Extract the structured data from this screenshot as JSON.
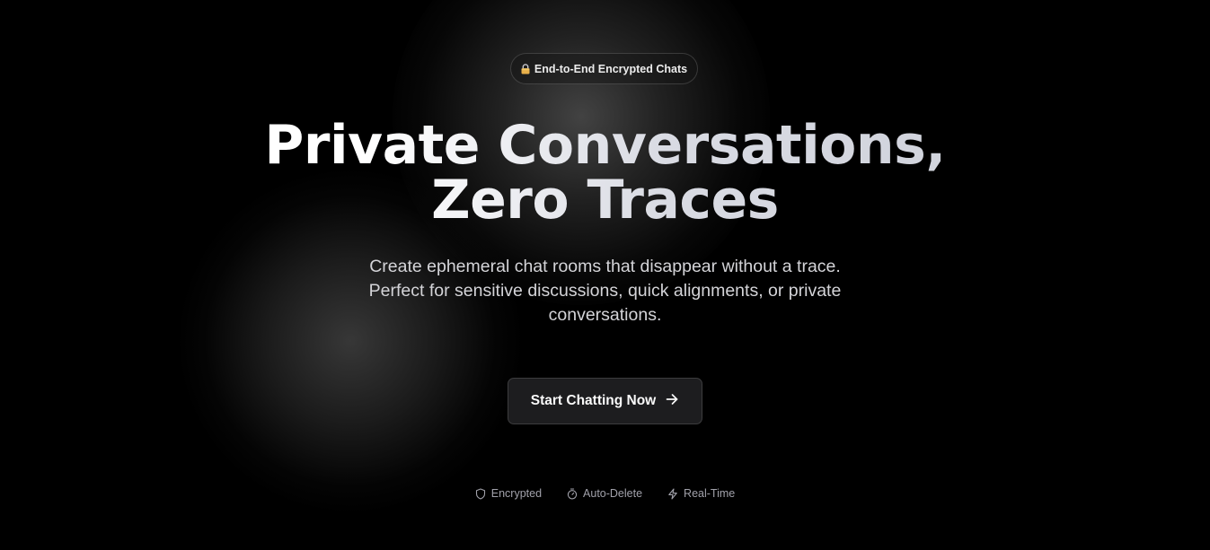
{
  "badge": {
    "icon": "lock-icon",
    "label": "End-to-End Encrypted Chats"
  },
  "hero": {
    "title_line1": "Private Conversations,",
    "title_line2": "Zero Traces",
    "subtitle": "Create ephemeral chat rooms that disappear without a trace. Perfect for sensitive discussions, quick alignments, or private conversations."
  },
  "cta": {
    "label": "Start Chatting Now",
    "icon": "arrow-right-icon"
  },
  "features": [
    {
      "icon": "shield-icon",
      "label": "Encrypted"
    },
    {
      "icon": "timer-icon",
      "label": "Auto-Delete"
    },
    {
      "icon": "zap-icon",
      "label": "Real-Time"
    }
  ],
  "colors": {
    "background": "#000000",
    "button_bg": "#1d1d1f",
    "subtitle_text": "#d4d4d8",
    "feature_text": "#a1a1aa"
  }
}
